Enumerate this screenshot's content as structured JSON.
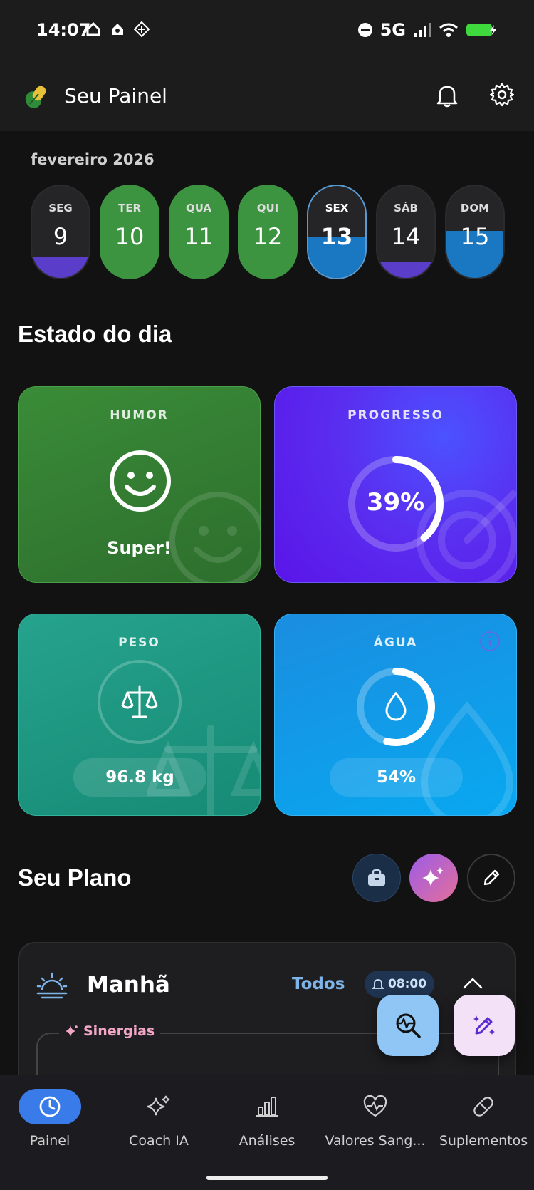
{
  "status_bar": {
    "time": "14:07",
    "network": "5G"
  },
  "header": {
    "title": "Seu Painel"
  },
  "calendar": {
    "month": "fevereiro 2026",
    "days": [
      {
        "name": "SEG",
        "num": "9"
      },
      {
        "name": "TER",
        "num": "10"
      },
      {
        "name": "QUA",
        "num": "11"
      },
      {
        "name": "QUI",
        "num": "12"
      },
      {
        "name": "SEX",
        "num": "13"
      },
      {
        "name": "SÁB",
        "num": "14"
      },
      {
        "name": "DOM",
        "num": "15"
      }
    ],
    "selected_day": "13"
  },
  "estado": {
    "title": "Estado do dia",
    "humor": {
      "label": "HUMOR",
      "value": "Super!"
    },
    "progresso": {
      "label": "PROGRESSO",
      "value": "39%",
      "percent": 39
    },
    "peso": {
      "label": "PESO",
      "value": "96.8 kg"
    },
    "agua": {
      "label": "ÁGUA",
      "value": "54%",
      "percent": 54
    }
  },
  "plano": {
    "title": "Seu Plano",
    "manha": {
      "title": "Manhã",
      "filter": "Todos",
      "alarm": "08:00"
    },
    "sinergias_label": "Sinergias"
  },
  "nav": {
    "items": [
      {
        "label": "Painel"
      },
      {
        "label": "Coach IA"
      },
      {
        "label": "Análises"
      },
      {
        "label": "Valores Sang..."
      },
      {
        "label": "Suplementos"
      }
    ]
  },
  "colors": {
    "green_card": "#3a8a3a",
    "purple_card": "#5a2ff0",
    "teal_card": "#1f9e8a",
    "blue_card": "#1aa3ee",
    "nav_active": "#3a7bea"
  }
}
